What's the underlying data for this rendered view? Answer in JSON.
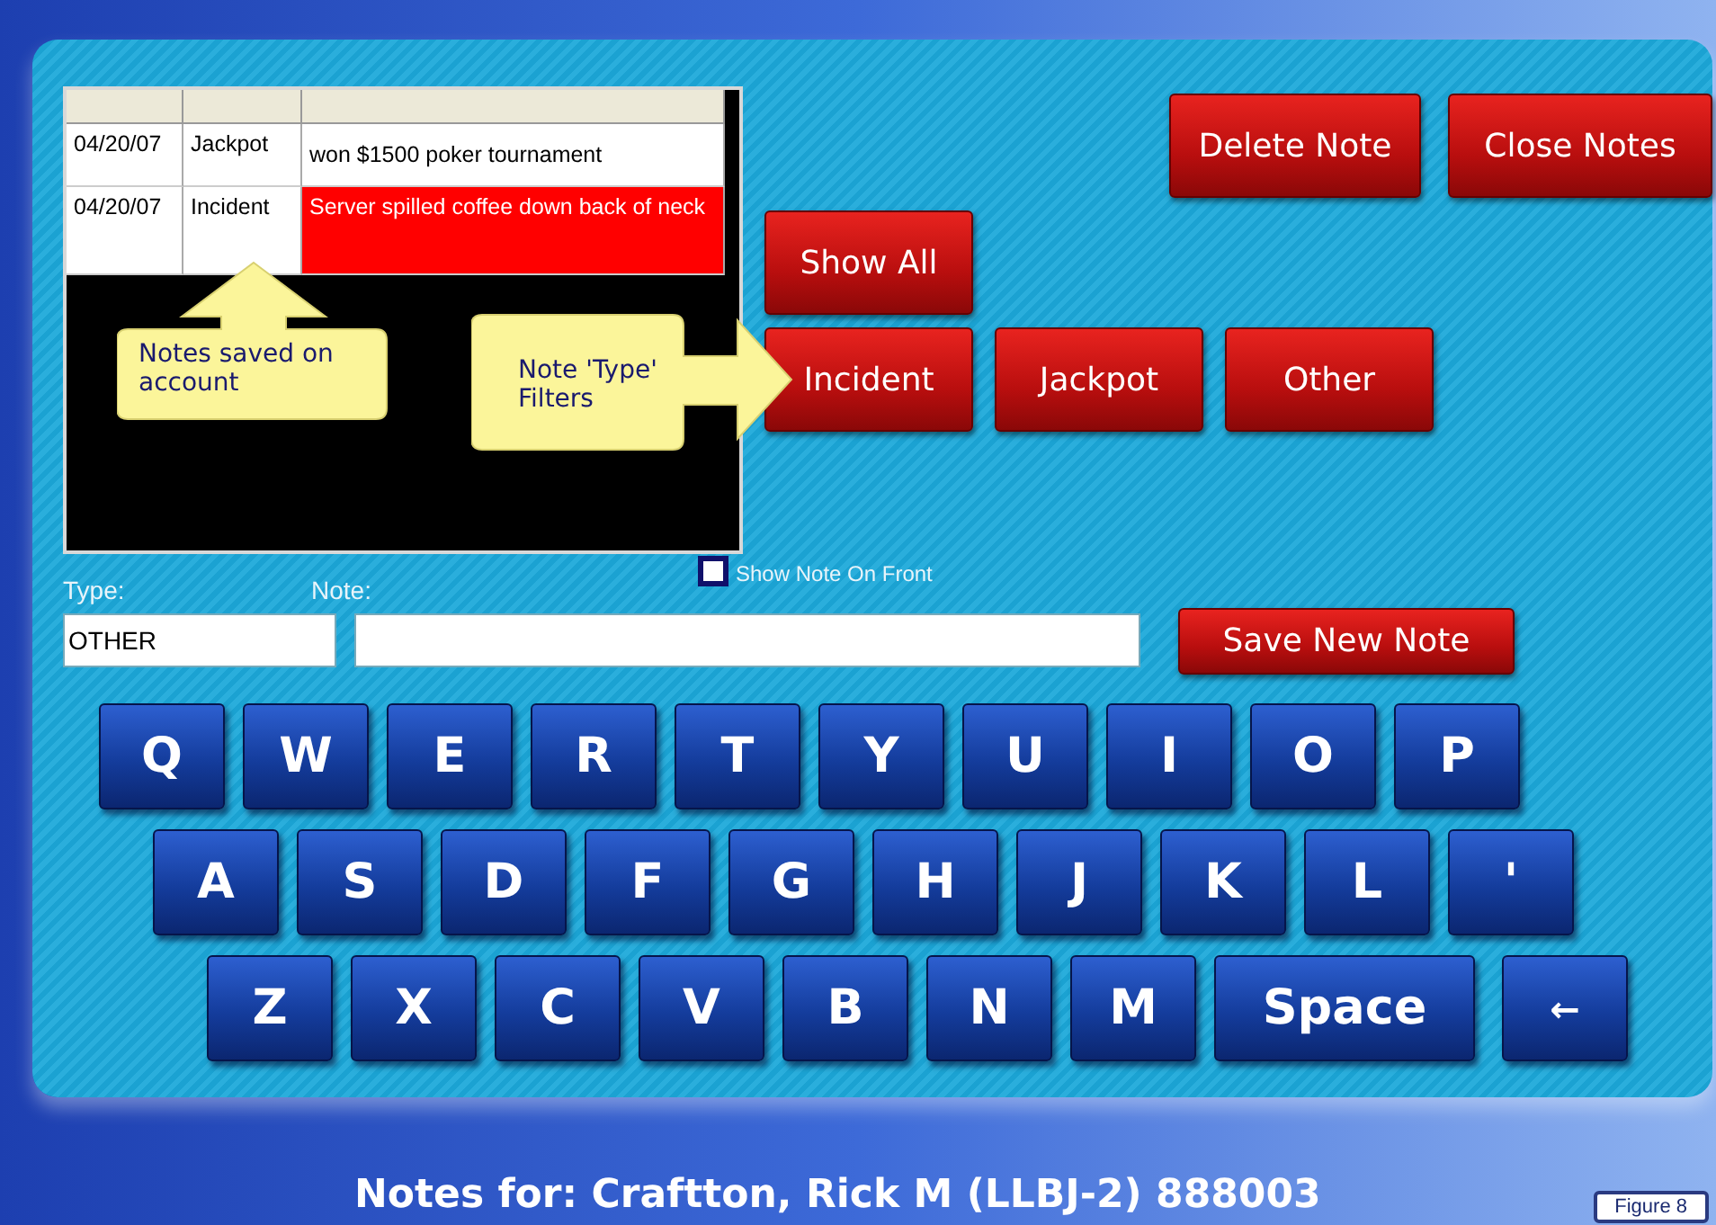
{
  "notes_table": {
    "columns": [
      "",
      "",
      ""
    ],
    "rows": [
      {
        "date": "04/20/07",
        "type": "Jackpot",
        "note": "won $1500 poker tournament",
        "selected": false
      },
      {
        "date": "04/20/07",
        "type": "Incident",
        "note": "Server spilled coffee down back of neck",
        "selected": true
      }
    ]
  },
  "callouts": [
    {
      "kind": "up",
      "text": "Notes saved on account"
    },
    {
      "kind": "right",
      "text": "Note 'Type' Filters"
    }
  ],
  "actions": [
    "Delete Note",
    "Close Notes"
  ],
  "show_all": "Show All",
  "filters": [
    "Incident",
    "Jackpot",
    "Other"
  ],
  "show_on_front": {
    "label": "Show Note On Front",
    "checked": false
  },
  "type_field": {
    "label": "Type:",
    "value": "OTHER"
  },
  "note_field": {
    "label": "Note:"
  },
  "save_button": "Save New Note",
  "keyboard": [
    [
      {
        "kind": "letter",
        "label": "Q"
      },
      {
        "kind": "letter",
        "label": "W"
      },
      {
        "kind": "letter",
        "label": "E"
      },
      {
        "kind": "letter",
        "label": "R"
      },
      {
        "kind": "letter",
        "label": "T"
      },
      {
        "kind": "letter",
        "label": "Y"
      },
      {
        "kind": "letter",
        "label": "U"
      },
      {
        "kind": "letter",
        "label": "I"
      },
      {
        "kind": "letter",
        "label": "O"
      },
      {
        "kind": "letter",
        "label": "P"
      }
    ],
    [
      {
        "kind": "letter",
        "label": "A"
      },
      {
        "kind": "letter",
        "label": "S"
      },
      {
        "kind": "letter",
        "label": "D"
      },
      {
        "kind": "letter",
        "label": "F"
      },
      {
        "kind": "letter",
        "label": "G"
      },
      {
        "kind": "letter",
        "label": "H"
      },
      {
        "kind": "letter",
        "label": "J"
      },
      {
        "kind": "letter",
        "label": "K"
      },
      {
        "kind": "letter",
        "label": "L"
      },
      {
        "kind": "letter",
        "label": "'"
      }
    ],
    [
      {
        "kind": "letter",
        "label": "Z"
      },
      {
        "kind": "letter",
        "label": "X"
      },
      {
        "kind": "letter",
        "label": "C"
      },
      {
        "kind": "letter",
        "label": "V"
      },
      {
        "kind": "letter",
        "label": "B"
      },
      {
        "kind": "letter",
        "label": "N"
      },
      {
        "kind": "letter",
        "label": "M"
      },
      {
        "kind": "space",
        "label": "Space"
      },
      {
        "kind": "backspace",
        "label": "←"
      }
    ]
  ],
  "footer_title": "Notes for: Craftton, Rick M (LLBJ-2) 888003",
  "figure_label": "Figure 8"
}
